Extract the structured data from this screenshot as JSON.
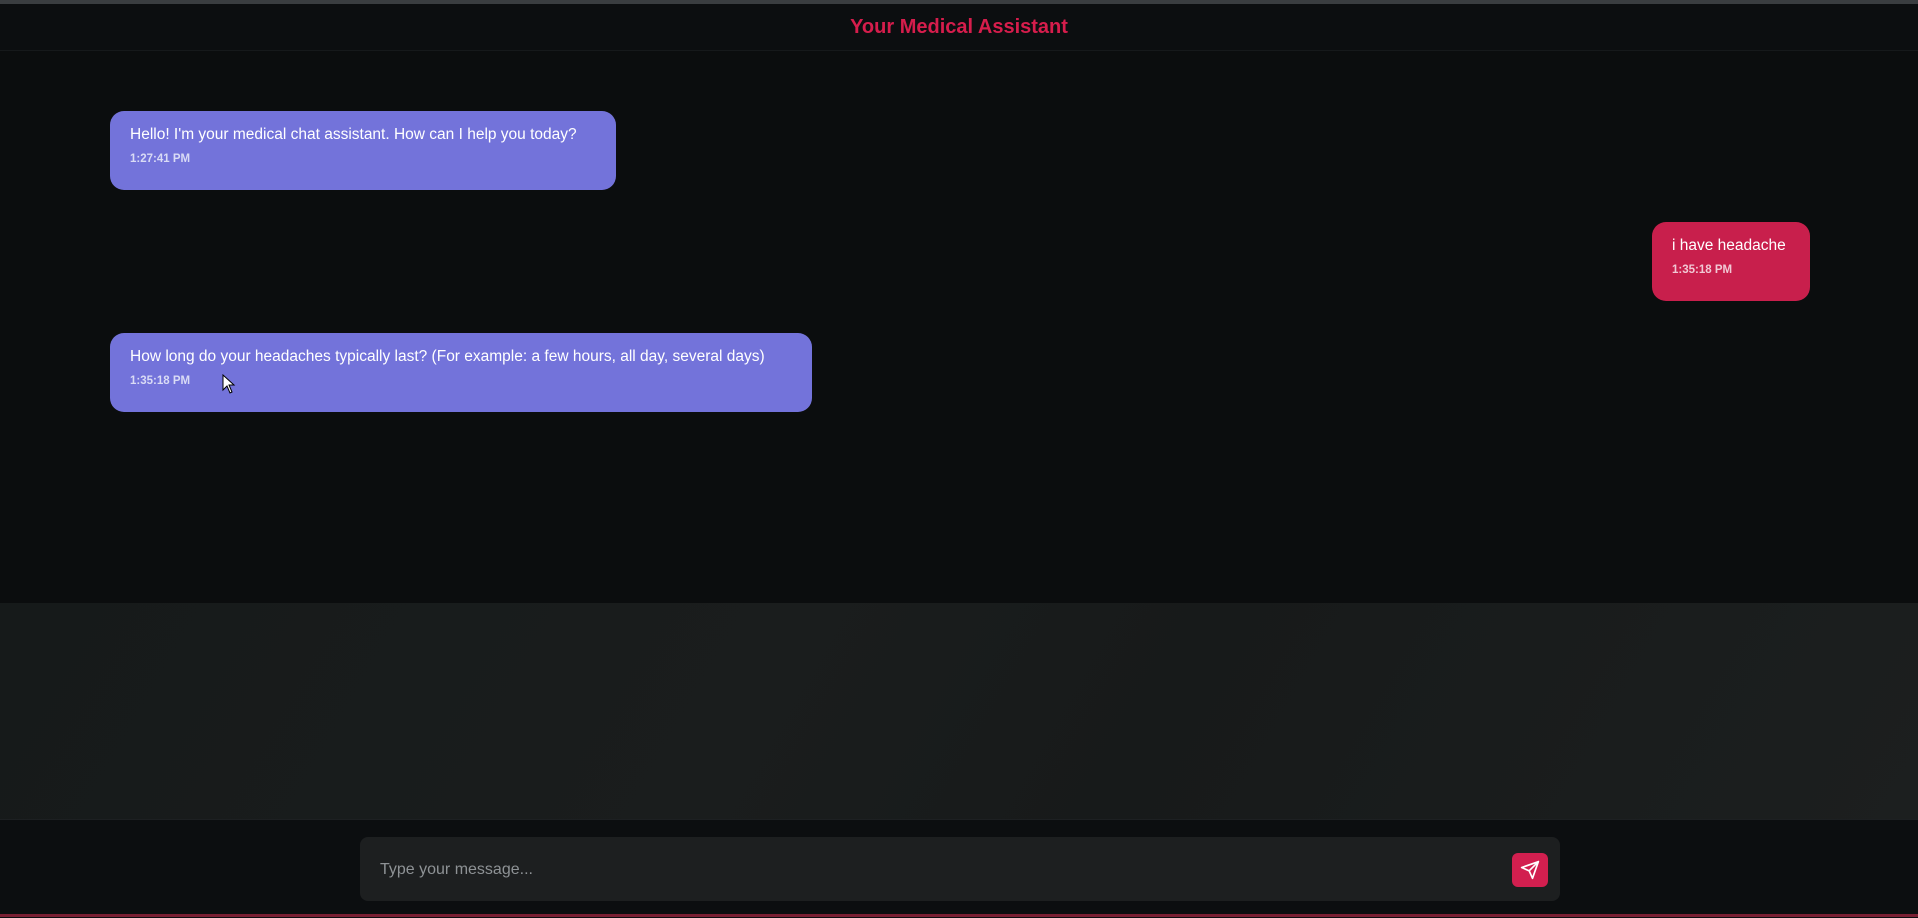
{
  "header": {
    "title": "Your Medical Assistant"
  },
  "messages": [
    {
      "sender": "bot",
      "text": "Hello! I'm your medical chat assistant. How can I help you today?",
      "time": "1:27:41 PM"
    },
    {
      "sender": "user",
      "text": "i have headache",
      "time": "1:35:18 PM"
    },
    {
      "sender": "bot",
      "text": "How long do your headaches typically last? (For example: a few hours, all day, several days)",
      "time": "1:35:18 PM"
    }
  ],
  "composer": {
    "placeholder": "Type your message...",
    "value": "",
    "send_icon": "send-icon"
  },
  "colors": {
    "accent": "#d61d4c",
    "bot_bubble": "#7373da",
    "user_bubble": "#c81f4c",
    "background": "#0b0d0e"
  }
}
